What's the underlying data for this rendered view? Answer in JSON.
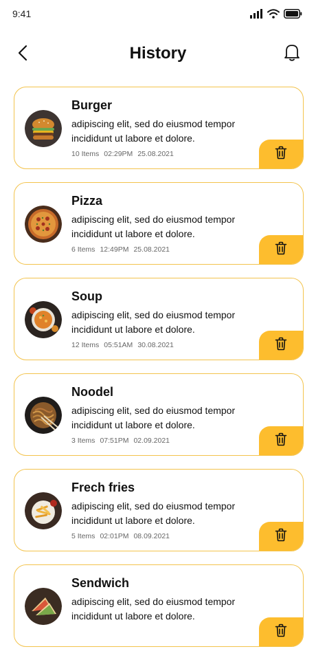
{
  "status_bar": {
    "time": "9:41",
    "icons": [
      "signal-icon",
      "wifi-icon",
      "battery-icon"
    ]
  },
  "header": {
    "title": "History",
    "back_icon": "back-arrow-icon",
    "notification_icon": "bell-icon"
  },
  "colors": {
    "accent": "#fdbd2e",
    "card_border": "#f3c34c"
  },
  "history_items": [
    {
      "name": "Burger",
      "description": "adipiscing elit, sed do eiusmod tempor incididunt ut labore et dolore.",
      "items": "10 Items",
      "time": "02:29PM",
      "date": "25.08.2021",
      "image": "burger-image"
    },
    {
      "name": "Pizza",
      "description": "adipiscing elit, sed do eiusmod tempor incididunt ut labore et dolore.",
      "items": "6 Items",
      "time": "12:49PM",
      "date": "25.08.2021",
      "image": "pizza-image"
    },
    {
      "name": "Soup",
      "description": "adipiscing elit, sed do eiusmod tempor incididunt ut labore et dolore.",
      "items": "12 Items",
      "time": "05:51AM",
      "date": "30.08.2021",
      "image": "soup-image"
    },
    {
      "name": "Noodel",
      "description": "adipiscing elit, sed do eiusmod tempor incididunt ut labore et dolore.",
      "items": "3 Items",
      "time": "07:51PM",
      "date": "02.09.2021",
      "image": "noodles-image"
    },
    {
      "name": "Frech fries",
      "description": "adipiscing elit, sed do eiusmod tempor incididunt ut labore et dolore.",
      "items": "5 Items",
      "time": "02:01PM",
      "date": "08.09.2021",
      "image": "fries-image"
    },
    {
      "name": "Sendwich",
      "description": "adipiscing elit, sed do eiusmod tempor incididunt ut labore et dolore.",
      "items": "",
      "time": "",
      "date": "",
      "image": "sandwich-image"
    }
  ]
}
